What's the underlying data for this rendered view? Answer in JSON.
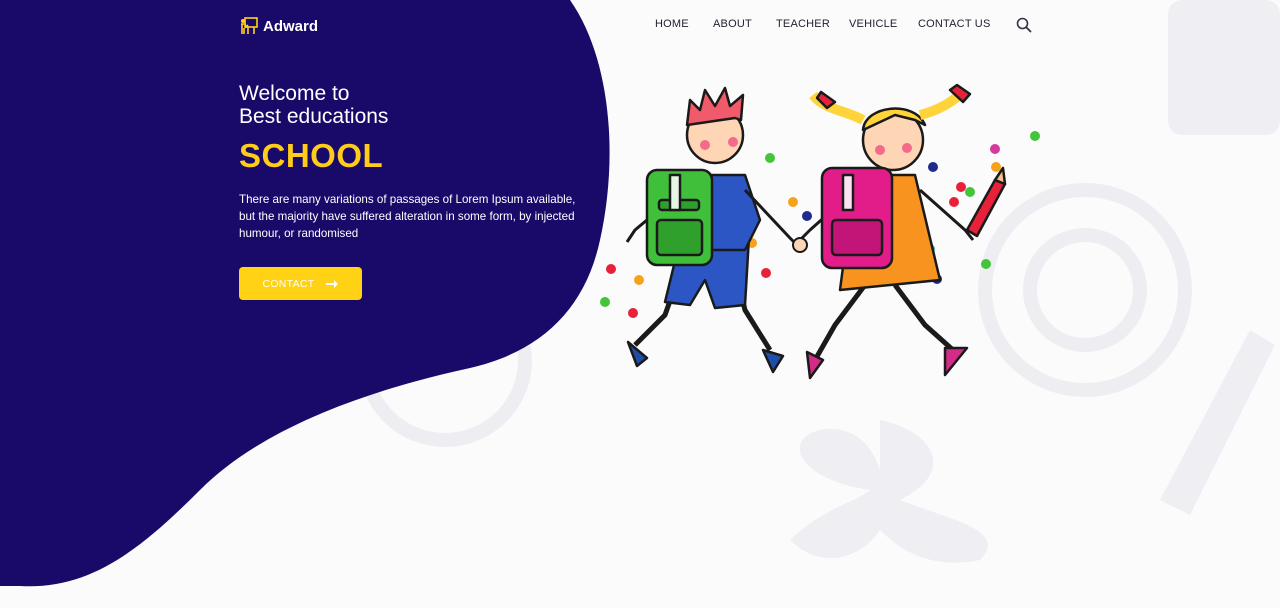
{
  "brand": {
    "name": "Adward"
  },
  "nav": {
    "items": [
      "HOME",
      "ABOUT",
      "TEACHER",
      "VEHICLE",
      "CONTACT US"
    ]
  },
  "hero": {
    "welcome_line1": "Welcome to",
    "welcome_line2": "Best educations",
    "headline": "SCHOOL",
    "description": "There are many variations of passages of Lorem Ipsum available, but the majority have suffered alteration in some form, by injected humour, or randomised",
    "cta_label": "CONTACT"
  },
  "icons": {
    "logo": "teacher-board-icon",
    "search": "search-icon",
    "cta_arrow": "arrow-right-icon"
  },
  "colors": {
    "navy": "#190a6a",
    "accent_yellow": "#ffd216",
    "nav_text": "#222233",
    "background": "#fbfbfc"
  }
}
